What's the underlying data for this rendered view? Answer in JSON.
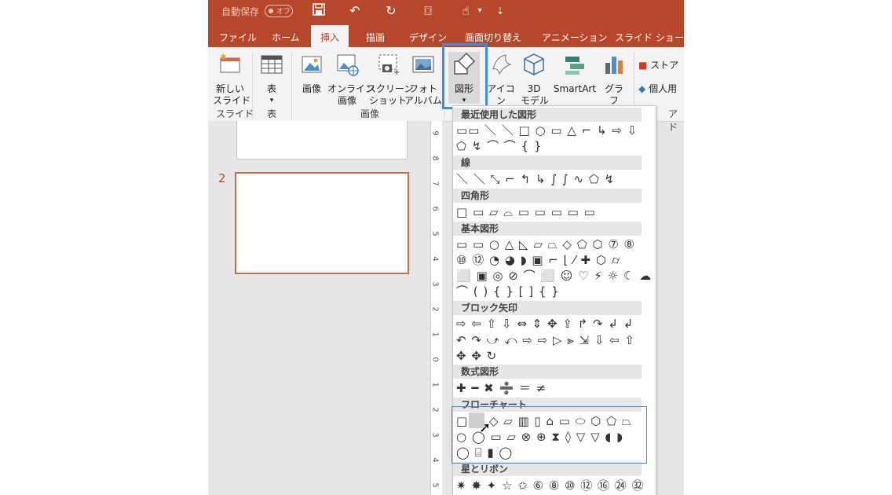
{
  "titlebar": {
    "autosave": "自動保存",
    "toggle": "オフ"
  },
  "tabs": [
    "ファイル",
    "ホーム",
    "挿入",
    "描画",
    "デザイン",
    "画面切り替え",
    "アニメーション",
    "スライド ショー"
  ],
  "ribbon": {
    "new_slide": "新しい\nスライド",
    "table": "表",
    "image": "画像",
    "online_image": "オンライン\n画像",
    "screenshot": "スクリーン\nショット",
    "photo_album": "フォト\nアルバム",
    "shapes": "図形",
    "icons": "アイコン",
    "3d_model": "3D\nモデル",
    "smartart": "SmartArt",
    "graph": "グラフ",
    "store": "ストア",
    "personal": "個人用",
    "group_slides": "スライド",
    "group_table": "表",
    "group_image": "画像",
    "group_addin": "アド"
  },
  "slides": {
    "thumb_number": "2"
  },
  "ruler": [
    "9",
    "8",
    "7",
    "6",
    "5",
    "4",
    "3",
    "2",
    "1",
    "0",
    "1",
    "2",
    "3",
    "4",
    "5"
  ],
  "shapes_menu": {
    "sections": [
      {
        "title": "最近使用した図形",
        "rows": [
          "▭▭ ＼ ＼ □ ○ ▭ △ ⌐ ↳ ⇨ ⇩",
          "⬠ ↯ ⌒ ⌒ { }"
        ]
      },
      {
        "title": "線",
        "rows": [
          "＼ ＼ ⤡ ⌐ ↰ ↳ ∫ ∫ ∿ ⬠ ↯"
        ]
      },
      {
        "title": "四角形",
        "rows": [
          "□ ▭ ▱ ⌓ ▭ ▭ ▭ ▭ ▭"
        ]
      },
      {
        "title": "基本図形",
        "rows": [
          "▭ ▭ ○ △ ◺ ▱ ⏢ ◇ ⬠ ⬡ ⑦ ⑧",
          "⑩ ⑫ ◔ ◕ ◗ ▣ ⌐ ⌊ ⁄ ✚ ⬡ ⌭",
          "⬜ ▣ ◎ ⊘ ⌒ ⬜ ☺ ♡ ⚡ ☼ ☾ ☁",
          "⌒ ( ) { } [ ] { }"
        ]
      },
      {
        "title": "ブロック矢印",
        "rows": [
          "⇨ ⇦ ⇧ ⇩ ⇔ ⇕ ✥ ⇪ ↱ ↷ ↲ ↲",
          "↶ ↷ ⤻ ⤺ ⇨ ⇨ ▷ ⪢ ⇲ ⇩ ⇦ ⇧",
          "✥ ✥ ↻"
        ]
      },
      {
        "title": "数式図形",
        "rows": [
          "✚ ━ ✖ ➗ ＝ ≠"
        ]
      },
      {
        "title": "フローチャート",
        "rows": [
          "□ ▢ ◇ ▱ ▥ ▯ ⌂ ▭ ⬭ ⬡ ⬠ ⏢",
          "○ ◯ ▭ ▱ ⊗ ⊕ ⧗ ◊ ▽ ▽ ◖ ◗",
          "◯ ⌸ ▮ ◯"
        ]
      },
      {
        "title": "星とリボン",
        "rows": [
          "✷ ✸ ✦ ☆ ✩ ⑥ ⑧ ⑩ ⑫ ⑯ ㉔ ㉜"
        ]
      }
    ]
  },
  "colors": {
    "accent": "#b7472a",
    "highlight": "#3b8fe0"
  }
}
